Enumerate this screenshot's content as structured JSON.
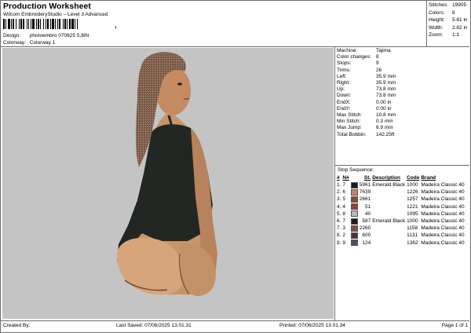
{
  "header": {
    "title": "Production Worksheet",
    "subtitle": "Wilcom EmbroideryStudio – Level 3 Advanced",
    "barcode_suffix": ","
  },
  "info": {
    "design_label": "Design:",
    "design_value": "photoembro 070625 5,8IN",
    "colorway_label": "Colorway:",
    "colorway_value": "Colorway 1"
  },
  "stats": [
    {
      "label": "Stitches:",
      "value": "19905"
    },
    {
      "label": "Colors:",
      "value": "8"
    },
    {
      "label": "Height:",
      "value": "5.81 in"
    },
    {
      "label": "Width:",
      "value": "2.82 in"
    },
    {
      "label": "Zoom:",
      "value": "1:1"
    }
  ],
  "machine": [
    {
      "label": "Machine:",
      "value": "Tajima"
    },
    {
      "label": "Color changes:",
      "value": "8"
    },
    {
      "label": "Stops:",
      "value": "9"
    },
    {
      "label": "Trims:",
      "value": "26"
    },
    {
      "label": "Left:",
      "value": "35.9 mm"
    },
    {
      "label": "Right:",
      "value": "35.9 mm"
    },
    {
      "label": "Up:",
      "value": "73.8 mm"
    },
    {
      "label": "Down:",
      "value": "73.8 mm"
    },
    {
      "label": "EndX:",
      "value": "0.00 in"
    },
    {
      "label": "EndY:",
      "value": "0.00 in"
    },
    {
      "label": "Max Stitch:",
      "value": "10.8 mm"
    },
    {
      "label": "Min Stitch:",
      "value": "0.3 mm"
    },
    {
      "label": "Max Jump:",
      "value": "6.9 mm"
    },
    {
      "label": "Total Bobbin:",
      "value": "142.25ft"
    }
  ],
  "stop_sequence": {
    "title": "Stop Sequence:",
    "headers": [
      "#",
      "N#",
      "St.",
      "Description",
      "Code",
      "Brand"
    ],
    "rows": [
      {
        "num": "1.",
        "n": "7",
        "color": "#1b1b1b",
        "st": "5961",
        "desc": "Emerald Black",
        "code": "1000",
        "brand": "Madeira Classic 40"
      },
      {
        "num": "2.",
        "n": "6",
        "color": "#c9826a",
        "st": "7639",
        "desc": "",
        "code": "1226",
        "brand": "Madeira Classic 40"
      },
      {
        "num": "3.",
        "n": "5",
        "color": "#8a4a36",
        "st": "2661",
        "desc": "",
        "code": "1257",
        "brand": "Madeira Classic 40"
      },
      {
        "num": "4.",
        "n": "4",
        "color": "#a23a2c",
        "st": "51",
        "desc": "",
        "code": "1221",
        "brand": "Madeira Classic 40"
      },
      {
        "num": "5.",
        "n": "8",
        "color": "#b9b9b9",
        "st": "40",
        "desc": "",
        "code": "1095",
        "brand": "Madeira Classic 40"
      },
      {
        "num": "6.",
        "n": "7",
        "color": "#1b1b1b",
        "st": "587",
        "desc": "Emerald Black",
        "code": "1000",
        "brand": "Madeira Classic 40"
      },
      {
        "num": "7.",
        "n": "3",
        "color": "#8b4b3b",
        "st": "2260",
        "desc": "",
        "code": "1158",
        "brand": "Madeira Classic 40"
      },
      {
        "num": "8.",
        "n": "2",
        "color": "#463734",
        "st": "600",
        "desc": "",
        "code": "1131",
        "brand": "Madeira Classic 40"
      },
      {
        "num": "9.",
        "n": "9",
        "color": "#4a4e63",
        "st": "124",
        "desc": "",
        "code": "1362",
        "brand": "Madeira Classic 40"
      }
    ]
  },
  "footer": {
    "created_by": "Created By:",
    "last_saved": "Last Saved: 07/06/2025 13.01.31",
    "printed": "Printed: 07/06/2025 13.01.34",
    "page": "Page 1 of 1"
  }
}
